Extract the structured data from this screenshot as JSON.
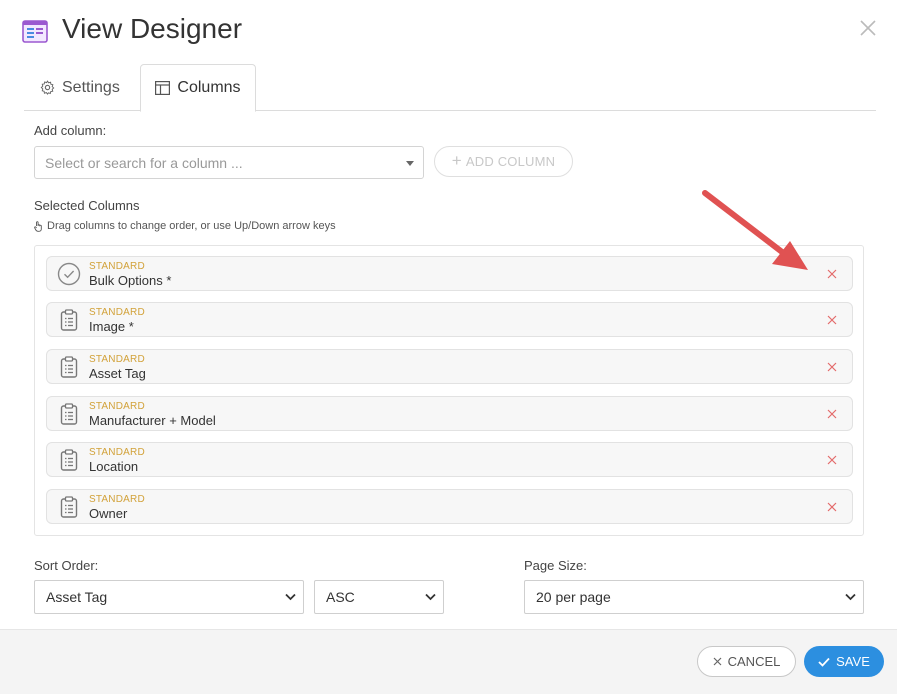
{
  "header": {
    "title": "View Designer"
  },
  "tabs": [
    {
      "label": "Settings",
      "icon": "gear-icon"
    },
    {
      "label": "Columns",
      "icon": "columns-icon",
      "active": true
    }
  ],
  "add_column": {
    "label": "Add column:",
    "placeholder": "Select or search for a column ...",
    "button_label": "ADD COLUMN"
  },
  "selected_columns": {
    "label": "Selected Columns",
    "hint": "Drag columns to change order, or use Up/Down arrow keys",
    "items": [
      {
        "tag": "STANDARD",
        "name": "Bulk Options *",
        "icon": "check-circle-icon"
      },
      {
        "tag": "STANDARD",
        "name": "Image *",
        "icon": "clipboard-icon"
      },
      {
        "tag": "STANDARD",
        "name": "Asset Tag",
        "icon": "clipboard-icon"
      },
      {
        "tag": "STANDARD",
        "name": "Manufacturer + Model",
        "icon": "clipboard-icon"
      },
      {
        "tag": "STANDARD",
        "name": "Location",
        "icon": "clipboard-icon"
      },
      {
        "tag": "STANDARD",
        "name": "Owner",
        "icon": "clipboard-icon"
      }
    ]
  },
  "sort": {
    "label": "Sort Order:",
    "field": "Asset Tag",
    "direction": "ASC"
  },
  "page_size": {
    "label": "Page Size:",
    "value": "20 per page"
  },
  "footer": {
    "cancel_label": "CANCEL",
    "save_label": "SAVE"
  },
  "colors": {
    "accent": "#2c8fe0",
    "tag": "#d2a23a",
    "remove": "#e46a6a",
    "annotation_arrow": "#e05252"
  }
}
